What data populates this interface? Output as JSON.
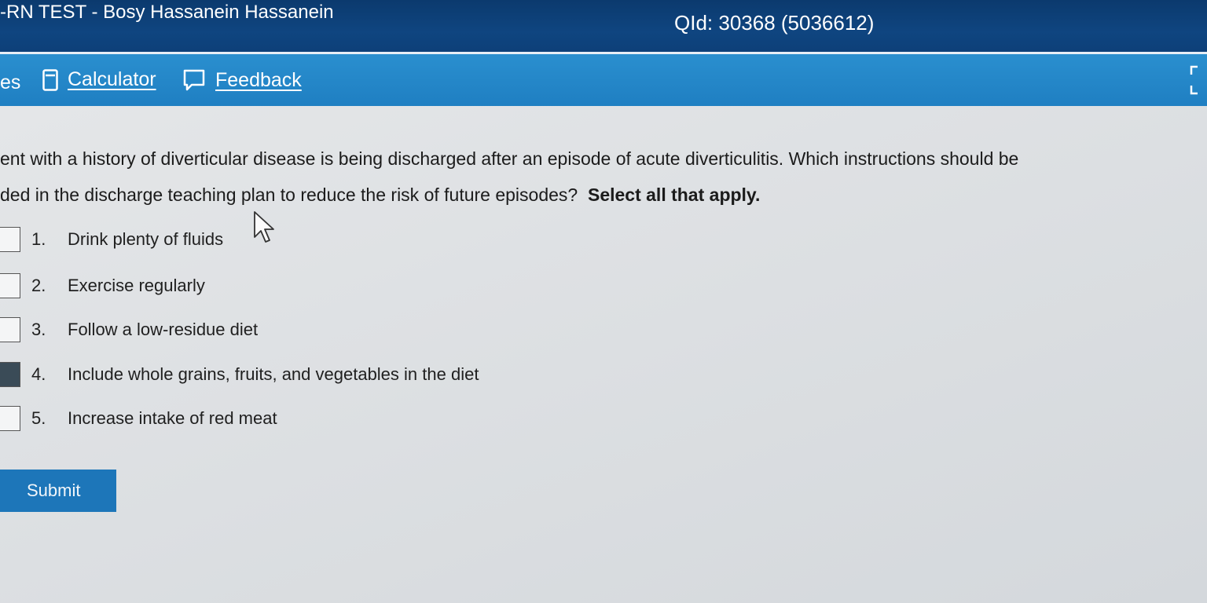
{
  "header": {
    "title": "-RN TEST - Bosy Hassanein Hassanein",
    "qid": "QId: 30368 (5036612)"
  },
  "toolbar": {
    "left_fragment": "es",
    "calculator_label": "Calculator",
    "feedback_label": "Feedback",
    "icons": {
      "calculator": "calculator-icon",
      "feedback": "speech-bubble-icon",
      "expand": "expand-bracket-icon"
    }
  },
  "question": {
    "text_line1": "ent with a history of diverticular disease is being discharged after an episode of acute diverticulitis.  Which instructions should be",
    "text_line2": "ded in the discharge teaching plan to reduce the risk of future episodes?",
    "instruction": "Select all that apply."
  },
  "options": [
    {
      "number": "1.",
      "label": "Drink plenty of fluids",
      "checked": false
    },
    {
      "number": "2.",
      "label": "Exercise regularly",
      "checked": false
    },
    {
      "number": "3.",
      "label": "Follow a low-residue diet",
      "checked": false
    },
    {
      "number": "4.",
      "label": "Include whole grains, fruits, and vegetables in the diet",
      "checked": true
    },
    {
      "number": "5.",
      "label": "Increase intake of red meat",
      "checked": false
    }
  ],
  "submit_label": "Submit",
  "colors": {
    "header_bg": "#0f4580",
    "toolbar_bg": "#2a8fcf",
    "submit_bg": "#1d76b9"
  }
}
